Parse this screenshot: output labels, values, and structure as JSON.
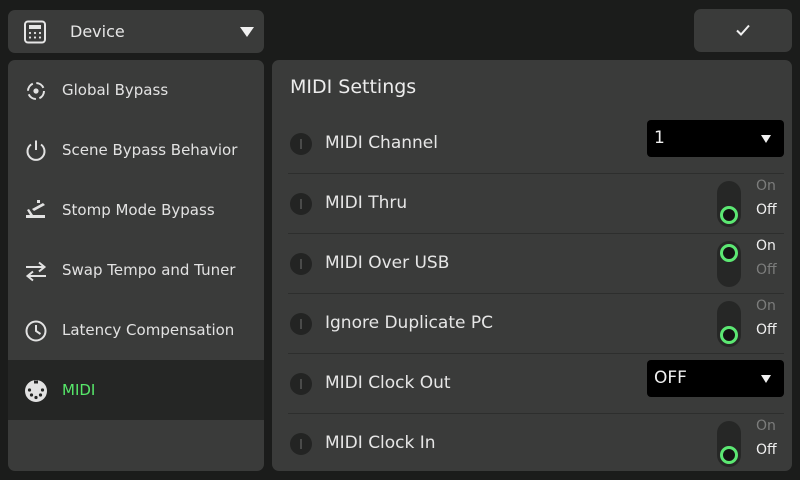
{
  "header": {
    "device_label": "Device",
    "device_icon": "device-unit-icon",
    "confirm_icon": "checkmark-icon"
  },
  "sidebar": {
    "items": [
      {
        "label": "Global Bypass",
        "icon": "bypass-target-icon",
        "active": false
      },
      {
        "label": "Scene Bypass Behavior",
        "icon": "power-icon",
        "active": false
      },
      {
        "label": "Stomp Mode Bypass",
        "icon": "stomp-footswitch-icon",
        "active": false
      },
      {
        "label": "Swap Tempo and Tuner",
        "icon": "swap-arrows-icon",
        "active": false
      },
      {
        "label": "Latency Compensation",
        "icon": "clock-icon",
        "active": false
      },
      {
        "label": "MIDI",
        "icon": "midi-connector-icon",
        "active": true
      }
    ],
    "accent_color": "#57e86a"
  },
  "main": {
    "title": "MIDI Settings",
    "rows": [
      {
        "label": "MIDI Channel",
        "control": "dropdown",
        "value": "1"
      },
      {
        "label": "MIDI Thru",
        "control": "toggle",
        "on_label": "On",
        "off_label": "Off",
        "state": "Off"
      },
      {
        "label": "MIDI Over USB",
        "control": "toggle",
        "on_label": "On",
        "off_label": "Off",
        "state": "On"
      },
      {
        "label": "Ignore Duplicate PC",
        "control": "toggle",
        "on_label": "On",
        "off_label": "Off",
        "state": "Off"
      },
      {
        "label": "MIDI Clock Out",
        "control": "dropdown",
        "value": "OFF"
      },
      {
        "label": "MIDI Clock In",
        "control": "toggle",
        "on_label": "On",
        "off_label": "Off",
        "state": "Off"
      }
    ]
  }
}
